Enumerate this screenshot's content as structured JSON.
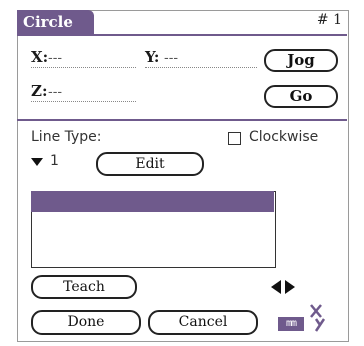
{
  "window": {
    "title": "Circle",
    "record_number": "# 1"
  },
  "coords": {
    "x_label": "X:",
    "x_value": "---",
    "y_label": "Y:",
    "y_value": "---",
    "z_label": "Z:",
    "z_value": "---"
  },
  "buttons": {
    "jog": "Jog",
    "go": "Go",
    "edit": "Edit",
    "teach": "Teach",
    "done": "Done",
    "cancel": "Cancel"
  },
  "line_type": {
    "label": "Line Type:",
    "selected": "1"
  },
  "clockwise": {
    "label": "Clockwise",
    "checked": false
  },
  "list": {
    "rows": [
      "",
      "",
      ""
    ],
    "selected_index": 0
  },
  "units": {
    "label": "mm"
  },
  "colors": {
    "accent": "#6f5a8c"
  }
}
